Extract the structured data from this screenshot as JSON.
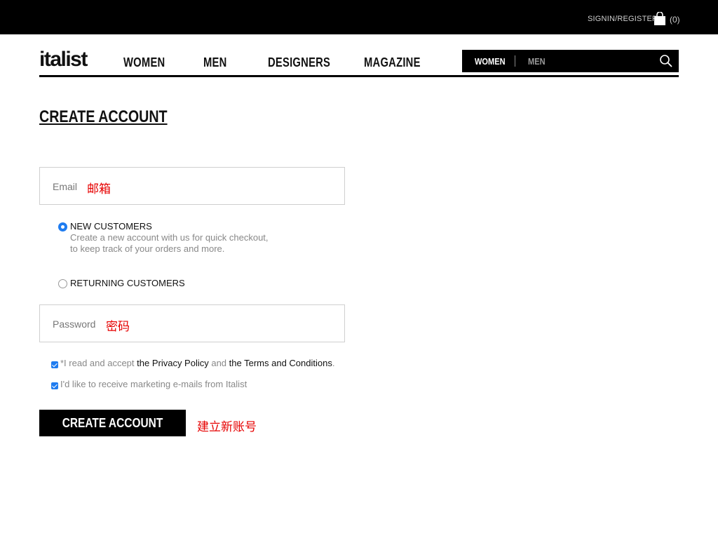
{
  "topbar": {
    "signin_label": "SIGNIN/REGISTER",
    "bag_count": "(0)",
    "bag_icon": "shopping-bag-icon"
  },
  "nav": {
    "logo": "italist",
    "links": [
      "WOMEN",
      "MEN",
      "DESIGNERS",
      "MAGAZINE"
    ],
    "search_tabs": {
      "women": "WOMEN",
      "men": "MEN"
    },
    "search_icon": "search-icon"
  },
  "page": {
    "title": "CREATE ACCOUNT",
    "email": {
      "label": "Email",
      "annotation": "邮箱"
    },
    "new_customers": {
      "label": "NEW CUSTOMERS",
      "desc_line1": "Create a new account with us for quick checkout,",
      "desc_line2": "to keep track of your orders and more.",
      "selected": true
    },
    "returning_customers": {
      "label": "RETURNING CUSTOMERS",
      "selected": false
    },
    "password": {
      "label": "Password",
      "annotation": "密码"
    },
    "terms": {
      "prefix": "*I read and accept ",
      "privacy": "the Privacy Policy",
      "and": " and ",
      "terms": "the Terms and Conditions",
      "suffix": "."
    },
    "marketing": "I'd like to receive marketing e-mails from Italist",
    "cta_label": "CREATE ACCOUNT",
    "cta_annotation": "建立新账号"
  },
  "colors": {
    "accent": "#1f7cf0",
    "annotation": "#e60000",
    "black": "#000000"
  }
}
